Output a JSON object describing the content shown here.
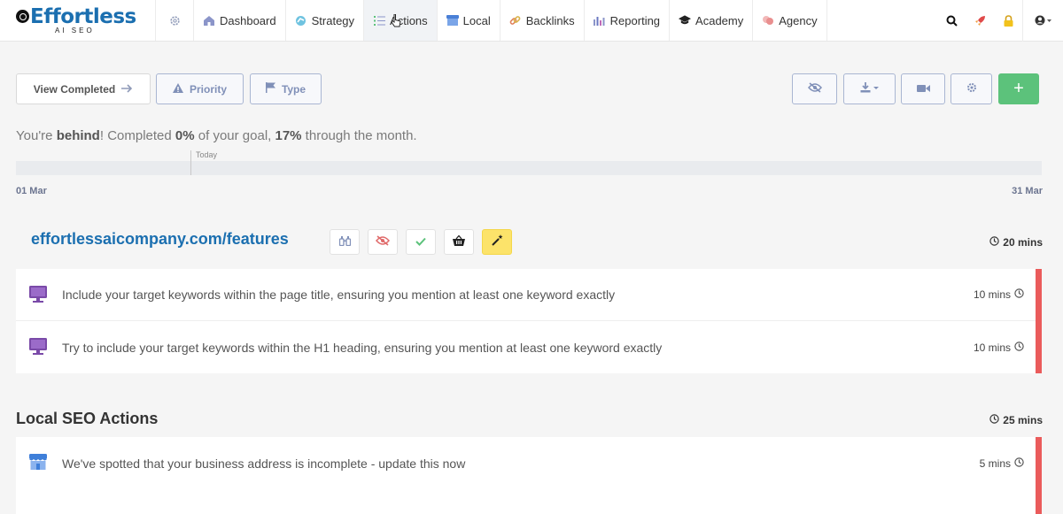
{
  "brand": {
    "name": "Effortless",
    "sub": "AI SEO",
    "color": "#1b6fb0"
  },
  "nav": {
    "settings_icon": "gear-icon",
    "items": [
      {
        "label": "Dashboard",
        "icon": "home-icon"
      },
      {
        "label": "Strategy",
        "icon": "strategy-icon"
      },
      {
        "label": "Actions",
        "icon": "checklist-icon"
      },
      {
        "label": "Local",
        "icon": "store-icon"
      },
      {
        "label": "Backlinks",
        "icon": "link-icon"
      },
      {
        "label": "Reporting",
        "icon": "bar-chart-icon"
      },
      {
        "label": "Academy",
        "icon": "graduation-cap-icon"
      },
      {
        "label": "Agency",
        "icon": "agency-icon"
      }
    ],
    "active": "Actions",
    "right_icons": [
      "search-icon",
      "rocket-icon",
      "lock-icon",
      "user-icon"
    ]
  },
  "toolbar": {
    "view_completed": "View Completed",
    "priority": "Priority",
    "type": "Type",
    "right_buttons": [
      "eye-off-icon",
      "download-icon",
      "video-icon",
      "settings-icon",
      "plus-icon"
    ],
    "plus": "+"
  },
  "goal": {
    "prefix": "You're ",
    "status": "behind",
    "mid": "! Completed ",
    "completed": "0%",
    "mid2": " of your goal, ",
    "through": "17%",
    "suffix": " through the month.",
    "today_label": "Today",
    "progress_completed": 0,
    "month_elapsed": 0.17,
    "start_date": "01 Mar",
    "end_date": "31 Mar"
  },
  "page_group": {
    "url": "effortlessaicompany.com/features",
    "icons": [
      "binoculars-icon",
      "eye-off-icon",
      "check-icon",
      "basket-icon",
      "magic-wand-icon"
    ],
    "total_time": "20 mins",
    "tasks": [
      {
        "text": "Include your target keywords within the page title, ensuring you mention at least one keyword exactly",
        "time": "10 mins",
        "icon": "monitor-icon"
      },
      {
        "text": "Try to include your target keywords within the H1 heading, ensuring you mention at least one keyword exactly",
        "time": "10 mins",
        "icon": "monitor-icon"
      }
    ]
  },
  "local_section": {
    "title": "Local SEO Actions",
    "total_time": "25 mins",
    "tasks": [
      {
        "text": "We've spotted that your business address is incomplete - update this now",
        "time": "5 mins",
        "icon": "store-icon"
      }
    ]
  },
  "colors": {
    "accent": "#1b6fb0",
    "green": "#5cc27b",
    "priority_bar": "#ea5b5b",
    "highlight": "#fce36a"
  }
}
